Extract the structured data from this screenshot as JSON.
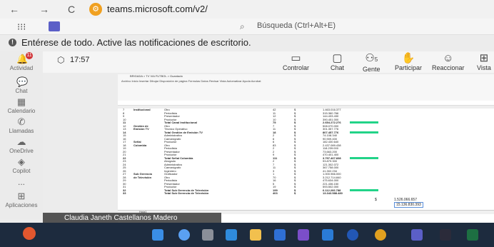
{
  "browser": {
    "back_icon": "←",
    "forward_icon": "→",
    "reload_icon": "C",
    "url": "teams.microsoft.com/v2/"
  },
  "teams": {
    "grid_icon": "⁝⁝⁝",
    "search_placeholder": "Búsqueda (Ctrl+Alt+E)",
    "notification": "Entérese de todo. Active las notificaciones de escritorio.",
    "notif_glyph": "!"
  },
  "rail": {
    "badge": "11",
    "items": [
      {
        "label": "Actividad",
        "icon": "🔔"
      },
      {
        "label": "Chat",
        "icon": "💬"
      },
      {
        "label": "Calendario",
        "icon": "▦"
      },
      {
        "label": "Llamadas",
        "icon": "✆"
      },
      {
        "label": "OneDrive",
        "icon": "☁"
      },
      {
        "label": "Copilot",
        "icon": "◈"
      },
      {
        "label": "...",
        "icon": ""
      },
      {
        "label": "Aplicaciones",
        "icon": "⊞"
      }
    ]
  },
  "call": {
    "timer": "17:57",
    "people_count": "5",
    "buttons": [
      {
        "label": "Controlar",
        "icon": "▭"
      },
      {
        "label": "Chat",
        "icon": "▢"
      },
      {
        "label": "Gente",
        "icon": "⚇"
      },
      {
        "label": "Participar",
        "icon": "✋"
      },
      {
        "label": "Reaccionar",
        "icon": "☺"
      },
      {
        "label": "Vista",
        "icon": "⊞"
      }
    ]
  },
  "excel": {
    "ribbon_title": "BRIGADA > TV VIA FUTBOL > Guardado",
    "ribbon_tabs": "Archivo  Inicio  Insertar  Dibujar  Disposición de página  Fórmulas  Datos  Revisar  Vista  Automatizar  Ayuda  Acrobat",
    "sheet_tab": "Hoja1",
    "rows": [
      {
        "num": "7",
        "cat": "Institucional",
        "sub": "Otro",
        "n": "42",
        "cur": "$",
        "val": "1.463.016.377"
      },
      {
        "num": "8",
        "cat": "",
        "sub": "Periodista",
        "n": "11",
        "cur": "$",
        "val": "315.360.766"
      },
      {
        "num": "9",
        "cat": "",
        "sub": "Presentador",
        "n": "12",
        "cur": "$",
        "val": "144.433.430"
      },
      {
        "num": "10",
        "cat": "",
        "sub": "Productor",
        "n": "10",
        "cur": "$",
        "val": "390.451.000"
      },
      {
        "num": "11",
        "cat": "",
        "sub": "Total Canal Institucional",
        "n": "75",
        "cur": "$",
        "val": "2.654.272.276",
        "total": true
      },
      {
        "num": "12",
        "cat": "Gestión de",
        "sub": "Otro",
        "n": "7",
        "cur": "$",
        "val": "508.070.000"
      },
      {
        "num": "13",
        "cat": "Emisión TV",
        "sub": "Técnico Operativo",
        "n": "11",
        "cur": "$",
        "val": "301.357.776"
      },
      {
        "num": "14",
        "cat": "",
        "sub": "Total Gestión de Emisión TV",
        "n": "18",
        "cur": "$",
        "val": "807.457.776",
        "total": true
      },
      {
        "num": "15",
        "cat": "",
        "sub": "Administrativo",
        "n": "2",
        "cur": "$",
        "val": "74.108.340"
      },
      {
        "num": "16",
        "cat": "",
        "sub": "Camarógrafo",
        "n": "6",
        "cur": "$",
        "val": "90.909.400"
      },
      {
        "num": "17",
        "cat": "Señal",
        "sub": "Productor",
        "n": "6",
        "cur": "$",
        "val": "182.430.640"
      },
      {
        "num": "18",
        "cat": "Colombia",
        "sub": "Otro",
        "n": "83",
        "cur": "$",
        "val": "2.437.089.438"
      },
      {
        "num": "19",
        "cat": "",
        "sub": "Periodista",
        "n": "2",
        "cur": "$",
        "val": "118.239.000"
      },
      {
        "num": "20",
        "cat": "",
        "sub": "Presentador",
        "n": "2",
        "cur": "$",
        "val": "73.663.200"
      },
      {
        "num": "21",
        "cat": "",
        "sub": "Productor",
        "n": "9",
        "cur": "$",
        "val": "470.401.400"
      },
      {
        "num": "22",
        "cat": "",
        "sub": "Total Señal Colombia",
        "n": "111",
        "cur": "$",
        "val": "3.797.467.838",
        "total": true
      },
      {
        "num": "23",
        "cat": "",
        "sub": "Abogado",
        "n": "2",
        "cur": "$",
        "val": "93.879.300"
      },
      {
        "num": "24",
        "cat": "",
        "sub": "Administrativo",
        "n": "7",
        "cur": "$",
        "val": "121.302.072"
      },
      {
        "num": "25",
        "cat": "",
        "sub": "Camarógrafo",
        "n": "11",
        "cur": "$",
        "val": "367.758.000"
      },
      {
        "num": "26",
        "cat": "",
        "sub": "Ingeniero",
        "n": "3",
        "cur": "$",
        "val": "41.302.234"
      },
      {
        "num": "27",
        "cat": "Sub Gerencia",
        "sub": "Graficador",
        "n": "1",
        "cur": "$",
        "val": "1.000.966.000"
      },
      {
        "num": "28",
        "cat": "de Televisión",
        "sub": "Otro",
        "n": "70",
        "cur": "$",
        "val": "3.212.714.840"
      },
      {
        "num": "29",
        "cat": "",
        "sub": "Periodista",
        "n": "16",
        "cur": "$",
        "val": "475.634.000"
      },
      {
        "num": "30",
        "cat": "",
        "sub": "Presentador",
        "n": "5",
        "cur": "$",
        "val": "221.436.150"
      },
      {
        "num": "31",
        "cat": "",
        "sub": "Productor",
        "n": "19",
        "cur": "$",
        "val": "593.502.000"
      },
      {
        "num": "32",
        "cat": "",
        "sub": "Total Sub Gerencia de Televisión",
        "n": "199",
        "cur": "$",
        "val": "6.112.266.788",
        "total": true
      },
      {
        "num": "33",
        "cat": "",
        "sub": "Total Sub Gerencia de Televisión",
        "n": "403",
        "cur": "$",
        "val": "13.343.588.480",
        "total": true
      }
    ],
    "summary": {
      "cur": "$",
      "val1": "1.526.066.657",
      "val2": "15.136.830.393"
    }
  },
  "presenter": {
    "name": "Claudia Janeth Castellanos Madero"
  },
  "colors": {
    "teams_purple": "#5b5fc7",
    "excel_green": "#22d388",
    "taskbar": "#1d2b3e"
  }
}
